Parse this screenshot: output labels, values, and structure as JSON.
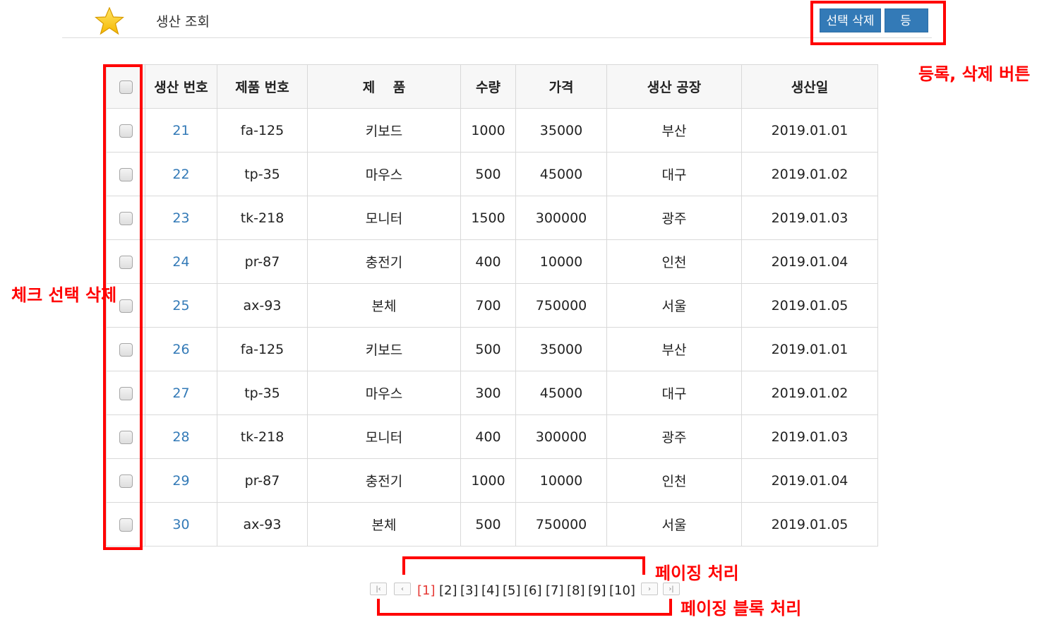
{
  "header": {
    "title": "생산 조회",
    "delete_button": "선택 삭제",
    "register_button": "등 록"
  },
  "table": {
    "columns": [
      "생산 번호",
      "제품 번호",
      "제 　품",
      "수량",
      "가격",
      "생산 공장",
      "생산일"
    ],
    "rows": [
      [
        "21",
        "fa-125",
        "키보드",
        "1000",
        "35000",
        "부산",
        "2019.01.01"
      ],
      [
        "22",
        "tp-35",
        "마우스",
        "500",
        "45000",
        "대구",
        "2019.01.02"
      ],
      [
        "23",
        "tk-218",
        "모니터",
        "1500",
        "300000",
        "광주",
        "2019.01.03"
      ],
      [
        "24",
        "pr-87",
        "충전기",
        "400",
        "10000",
        "인천",
        "2019.01.04"
      ],
      [
        "25",
        "ax-93",
        "본체",
        "700",
        "750000",
        "서울",
        "2019.01.05"
      ],
      [
        "26",
        "fa-125",
        "키보드",
        "500",
        "35000",
        "부산",
        "2019.01.01"
      ],
      [
        "27",
        "tp-35",
        "마우스",
        "300",
        "45000",
        "대구",
        "2019.01.02"
      ],
      [
        "28",
        "tk-218",
        "모니터",
        "400",
        "300000",
        "광주",
        "2019.01.03"
      ],
      [
        "29",
        "pr-87",
        "충전기",
        "1000",
        "10000",
        "인천",
        "2019.01.04"
      ],
      [
        "30",
        "ax-93",
        "본체",
        "500",
        "750000",
        "서울",
        "2019.01.05"
      ]
    ]
  },
  "pagination": {
    "first": "|‹",
    "prev": "‹",
    "next": "›",
    "last": "›|",
    "pages": [
      "[1]",
      "[2]",
      "[3]",
      "[4]",
      "[5]",
      "[6]",
      "[7]",
      "[8]",
      "[9]",
      "[10]"
    ],
    "current": "[1]"
  },
  "annotations": {
    "buttons_note": "등록, 삭제 버튼",
    "checkbox_note": "체크 선택 삭제",
    "paging_note": "페이징 처리",
    "paging_block_note": "페이징 블록 처리"
  },
  "colors": {
    "accent": "#337ab7",
    "annotation": "#ff0000",
    "active_page": "#e53935"
  }
}
